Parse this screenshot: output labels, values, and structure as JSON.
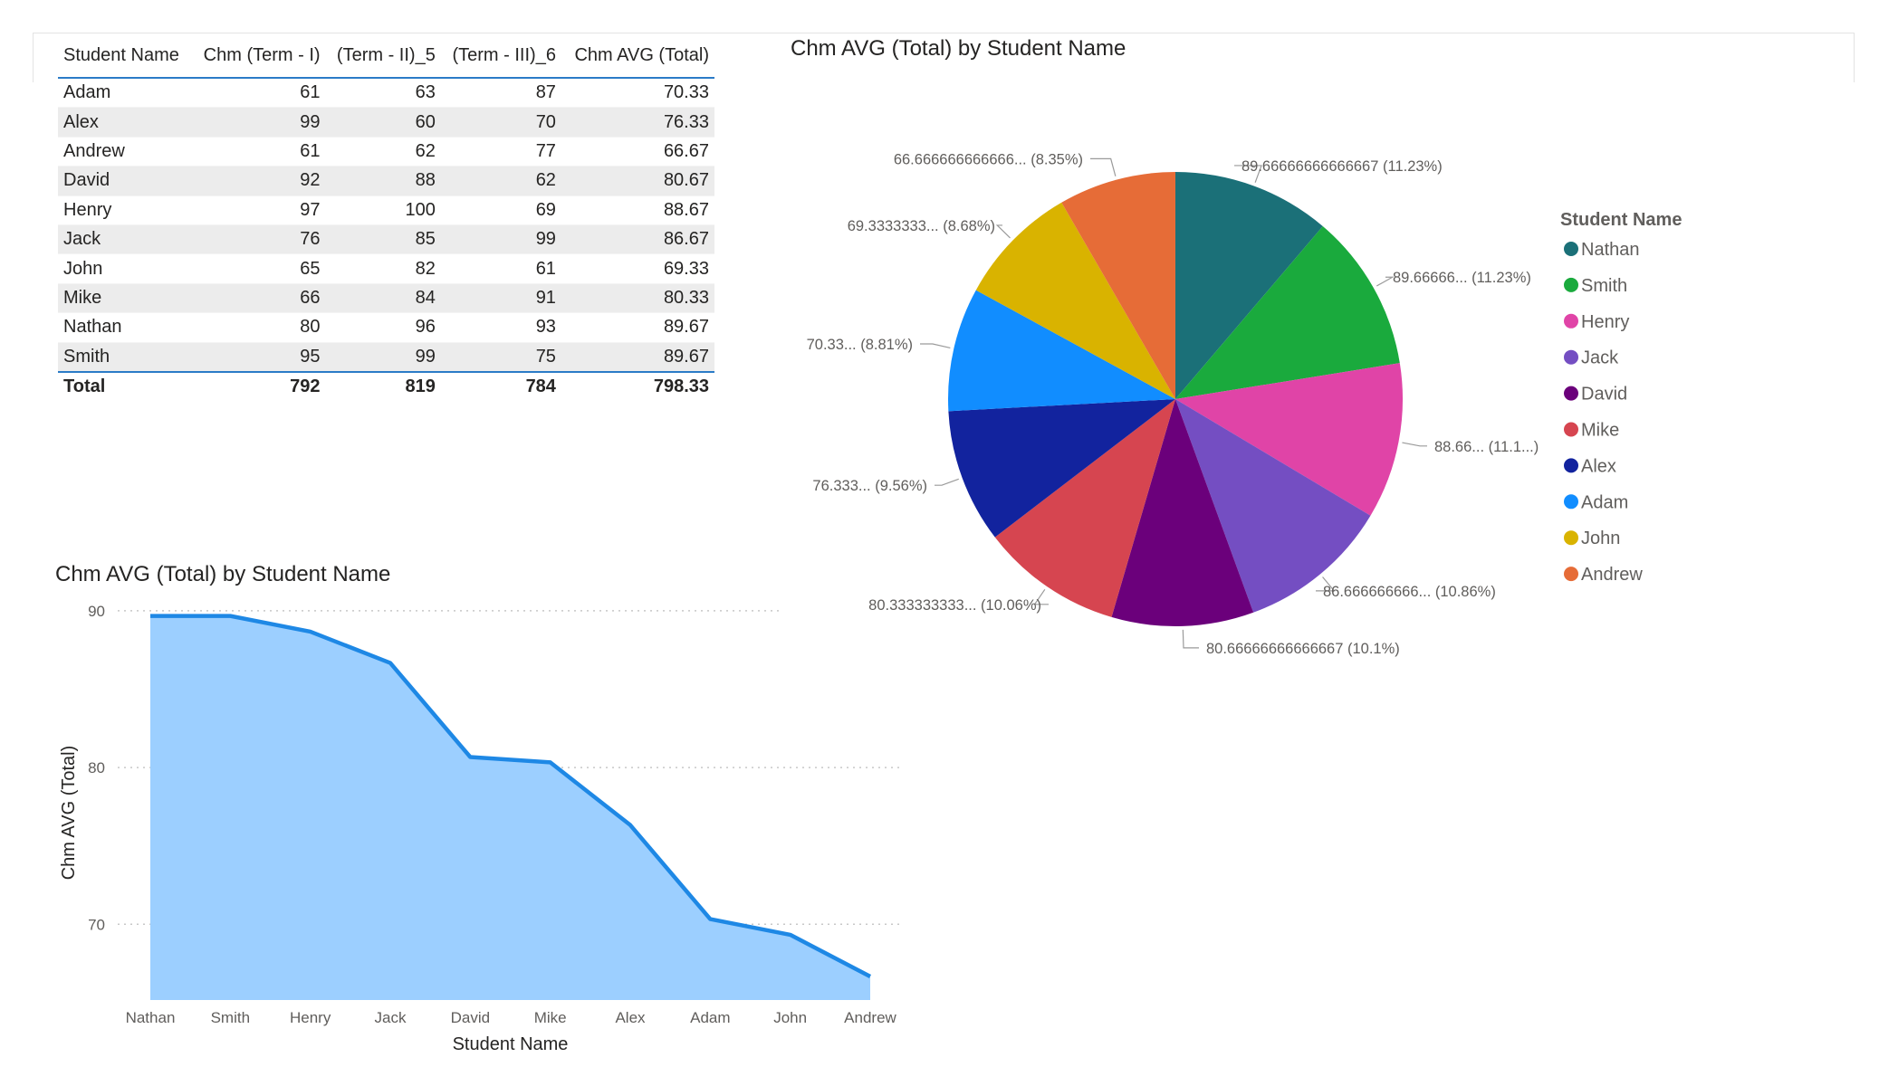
{
  "table": {
    "headers": [
      "Student Name",
      "Chm (Term - I)",
      "(Term - II)_5",
      "(Term - III)_6",
      "Chm AVG (Total)"
    ],
    "rows": [
      [
        "Adam",
        "61",
        "63",
        "87",
        "70.33"
      ],
      [
        "Alex",
        "99",
        "60",
        "70",
        "76.33"
      ],
      [
        "Andrew",
        "61",
        "62",
        "77",
        "66.67"
      ],
      [
        "David",
        "92",
        "88",
        "62",
        "80.67"
      ],
      [
        "Henry",
        "97",
        "100",
        "69",
        "88.67"
      ],
      [
        "Jack",
        "76",
        "85",
        "99",
        "86.67"
      ],
      [
        "John",
        "65",
        "82",
        "61",
        "69.33"
      ],
      [
        "Mike",
        "66",
        "84",
        "91",
        "80.33"
      ],
      [
        "Nathan",
        "80",
        "96",
        "93",
        "89.67"
      ],
      [
        "Smith",
        "95",
        "99",
        "75",
        "89.67"
      ]
    ],
    "total": [
      "Total",
      "792",
      "819",
      "784",
      "798.33"
    ]
  },
  "area_chart": {
    "title": "Chm AVG (Total) by Student Name"
  },
  "pie_chart": {
    "title": "Chm AVG (Total) by Student Name",
    "legend_title": "Student Name"
  },
  "chart_data": [
    {
      "type": "area",
      "title": "Chm AVG (Total) by Student Name",
      "xlabel": "Student Name",
      "ylabel": "Chm AVG (Total)",
      "categories": [
        "Nathan",
        "Smith",
        "Henry",
        "Jack",
        "David",
        "Mike",
        "Alex",
        "Adam",
        "John",
        "Andrew"
      ],
      "values": [
        89.67,
        89.67,
        88.67,
        86.67,
        80.67,
        80.33,
        76.33,
        70.33,
        69.33,
        66.67
      ],
      "yticks": [
        70,
        80,
        90
      ],
      "ylim": [
        65,
        90.5
      ],
      "grid": true,
      "color": "#1e88e5",
      "fill": "#9ccfff"
    },
    {
      "type": "pie",
      "title": "Chm AVG (Total) by Student Name",
      "legend_title": "Student Name",
      "legend_position": "right",
      "slices": [
        {
          "name": "Nathan",
          "value": 89.67,
          "label": "89.66666666666667 (11.23%)",
          "color": "#1b7078"
        },
        {
          "name": "Smith",
          "value": 89.67,
          "label": "89.66666... (11.23%)",
          "color": "#1aaa3d"
        },
        {
          "name": "Henry",
          "value": 88.67,
          "label": "88.66... (11.1...)",
          "color": "#e044a7"
        },
        {
          "name": "Jack",
          "value": 86.67,
          "label": "86.666666666... (10.86%)",
          "color": "#744ec2"
        },
        {
          "name": "David",
          "value": 80.67,
          "label": "80.66666666666667 (10.1%)",
          "color": "#6b007b"
        },
        {
          "name": "Mike",
          "value": 80.33,
          "label": "80.333333333... (10.06%)",
          "color": "#d64550"
        },
        {
          "name": "Alex",
          "value": 76.33,
          "label": "76.333... (9.56%)",
          "color": "#12239e"
        },
        {
          "name": "Adam",
          "value": 70.33,
          "label": "70.33... (8.81%)",
          "color": "#118dff"
        },
        {
          "name": "John",
          "value": 69.33,
          "label": "69.3333333... (8.68%)",
          "color": "#d9b300"
        },
        {
          "name": "Andrew",
          "value": 66.67,
          "label": "66.666666666666... (8.35%)",
          "color": "#e66c37"
        }
      ]
    }
  ]
}
